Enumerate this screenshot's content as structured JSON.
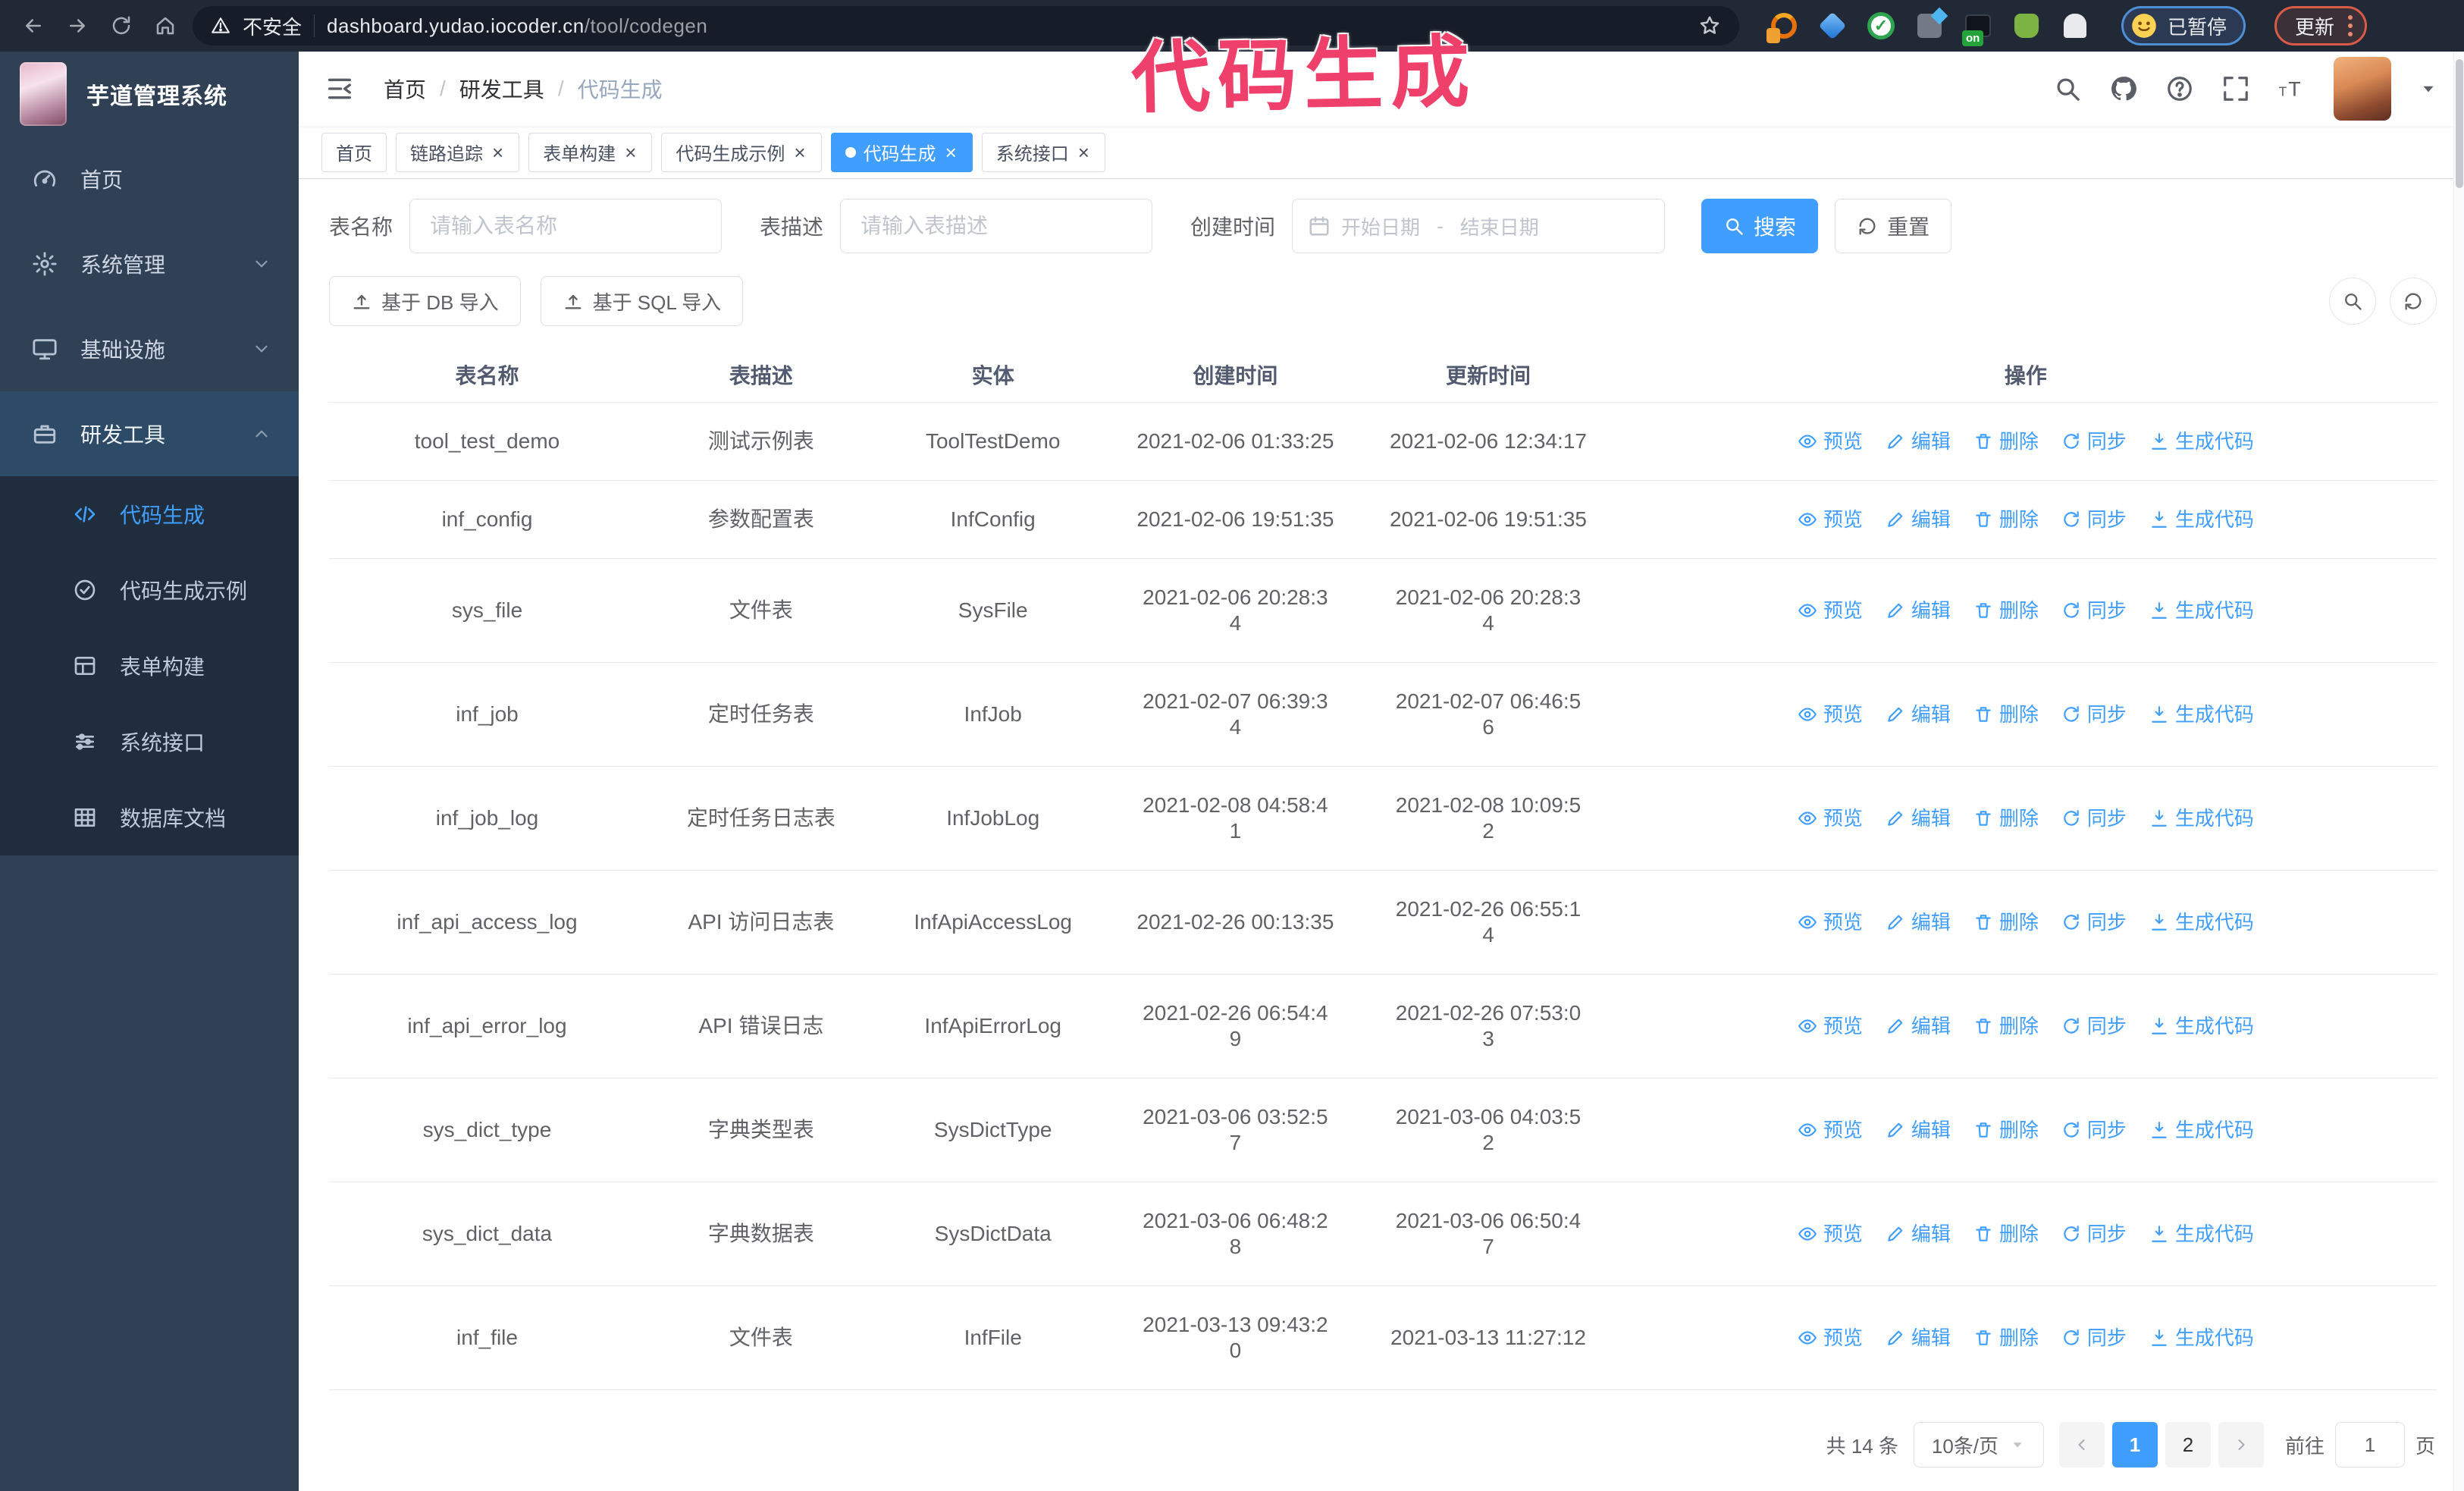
{
  "annotation": {
    "text": "代码生成",
    "color": "#ef3f6b"
  },
  "browser": {
    "security_label": "不安全",
    "url_host": "dashboard.yudao.iocoder.cn",
    "url_path": "/tool/codegen",
    "paused_badge": "已暂停",
    "update_button": "更新"
  },
  "app": {
    "title": "芋道管理系统"
  },
  "breadcrumb": {
    "items": [
      "首页",
      "研发工具",
      "代码生成"
    ],
    "separator": "/"
  },
  "sidebar": {
    "items": [
      {
        "id": "home",
        "label": "首页",
        "icon": "dashboard-icon"
      },
      {
        "id": "system",
        "label": "系统管理",
        "icon": "gear-icon",
        "chevron": "down"
      },
      {
        "id": "infra",
        "label": "基础设施",
        "icon": "monitor-icon",
        "chevron": "down"
      },
      {
        "id": "devtools",
        "label": "研发工具",
        "icon": "toolbox-icon",
        "chevron": "up",
        "open": true
      }
    ],
    "subitems": [
      {
        "id": "codegen",
        "label": "代码生成",
        "icon": "code-icon",
        "active": true
      },
      {
        "id": "codegen-example",
        "label": "代码生成示例",
        "icon": "example-icon"
      },
      {
        "id": "form-builder",
        "label": "表单构建",
        "icon": "form-icon"
      },
      {
        "id": "system-api",
        "label": "系统接口",
        "icon": "api-icon"
      },
      {
        "id": "db-doc",
        "label": "数据库文档",
        "icon": "database-icon"
      }
    ]
  },
  "tabs": [
    {
      "label": "首页",
      "closable": false,
      "active": false
    },
    {
      "label": "链路追踪",
      "closable": true,
      "active": false
    },
    {
      "label": "表单构建",
      "closable": true,
      "active": false
    },
    {
      "label": "代码生成示例",
      "closable": true,
      "active": false
    },
    {
      "label": "代码生成",
      "closable": true,
      "active": true
    },
    {
      "label": "系统接口",
      "closable": true,
      "active": false
    }
  ],
  "filters": {
    "name_label": "表名称",
    "name_placeholder": "请输入表名称",
    "desc_label": "表描述",
    "desc_placeholder": "请输入表描述",
    "time_label": "创建时间",
    "start_placeholder": "开始日期",
    "range_separator": "-",
    "end_placeholder": "结束日期",
    "search_label": "搜索",
    "reset_label": "重置"
  },
  "toolbar": {
    "import_db_label": "基于 DB 导入",
    "import_sql_label": "基于 SQL 导入"
  },
  "table": {
    "headers": [
      "表名称",
      "表描述",
      "实体",
      "创建时间",
      "更新时间",
      "操作"
    ],
    "actions": [
      {
        "key": "preview",
        "label": "预览",
        "icon": "eye-icon"
      },
      {
        "key": "edit",
        "label": "编辑",
        "icon": "edit-icon"
      },
      {
        "key": "delete",
        "label": "删除",
        "icon": "delete-icon"
      },
      {
        "key": "sync",
        "label": "同步",
        "icon": "sync-icon"
      },
      {
        "key": "generate",
        "label": "生成代码",
        "icon": "download-icon"
      }
    ],
    "rows": [
      {
        "name": "tool_test_demo",
        "desc": "测试示例表",
        "entity": "ToolTestDemo",
        "create_time": "2021-02-06 01:33:25",
        "update_time": "2021-02-06 12:34:17"
      },
      {
        "name": "inf_config",
        "desc": "参数配置表",
        "entity": "InfConfig",
        "create_time": "2021-02-06 19:51:35",
        "update_time": "2021-02-06 19:51:35"
      },
      {
        "name": "sys_file",
        "desc": "文件表",
        "entity": "SysFile",
        "create_time": "2021-02-06 20:28:3\n4",
        "update_time": "2021-02-06 20:28:3\n4"
      },
      {
        "name": "inf_job",
        "desc": "定时任务表",
        "entity": "InfJob",
        "create_time": "2021-02-07 06:39:3\n4",
        "update_time": "2021-02-07 06:46:5\n6"
      },
      {
        "name": "inf_job_log",
        "desc": "定时任务日志表",
        "entity": "InfJobLog",
        "create_time": "2021-02-08 04:58:4\n1",
        "update_time": "2021-02-08 10:09:5\n2"
      },
      {
        "name": "inf_api_access_log",
        "desc": "API 访问日志表",
        "entity": "InfApiAccessLog",
        "create_time": "2021-02-26 00:13:35",
        "update_time": "2021-02-26 06:55:1\n4"
      },
      {
        "name": "inf_api_error_log",
        "desc": "API 错误日志",
        "entity": "InfApiErrorLog",
        "create_time": "2021-02-26 06:54:4\n9",
        "update_time": "2021-02-26 07:53:0\n3"
      },
      {
        "name": "sys_dict_type",
        "desc": "字典类型表",
        "entity": "SysDictType",
        "create_time": "2021-03-06 03:52:5\n7",
        "update_time": "2021-03-06 04:03:5\n2"
      },
      {
        "name": "sys_dict_data",
        "desc": "字典数据表",
        "entity": "SysDictData",
        "create_time": "2021-03-06 06:48:2\n8",
        "update_time": "2021-03-06 06:50:4\n7"
      },
      {
        "name": "inf_file",
        "desc": "文件表",
        "entity": "InfFile",
        "create_time": "2021-03-13 09:43:2\n0",
        "update_time": "2021-03-13 11:27:12"
      }
    ]
  },
  "pagination": {
    "total_text": "共 14 条",
    "page_size": "10条/页",
    "pages": [
      {
        "label": "1",
        "active": true
      },
      {
        "label": "2",
        "active": false
      }
    ],
    "goto_label": "前往",
    "goto_value": "1",
    "goto_suffix": "页"
  },
  "colors": {
    "accent": "#409EFF",
    "sidebar_bg": "#304156",
    "submenu_bg": "#1f2d3d",
    "annotation_pink": "#ef3f6b",
    "browser_bar": "#212936"
  }
}
